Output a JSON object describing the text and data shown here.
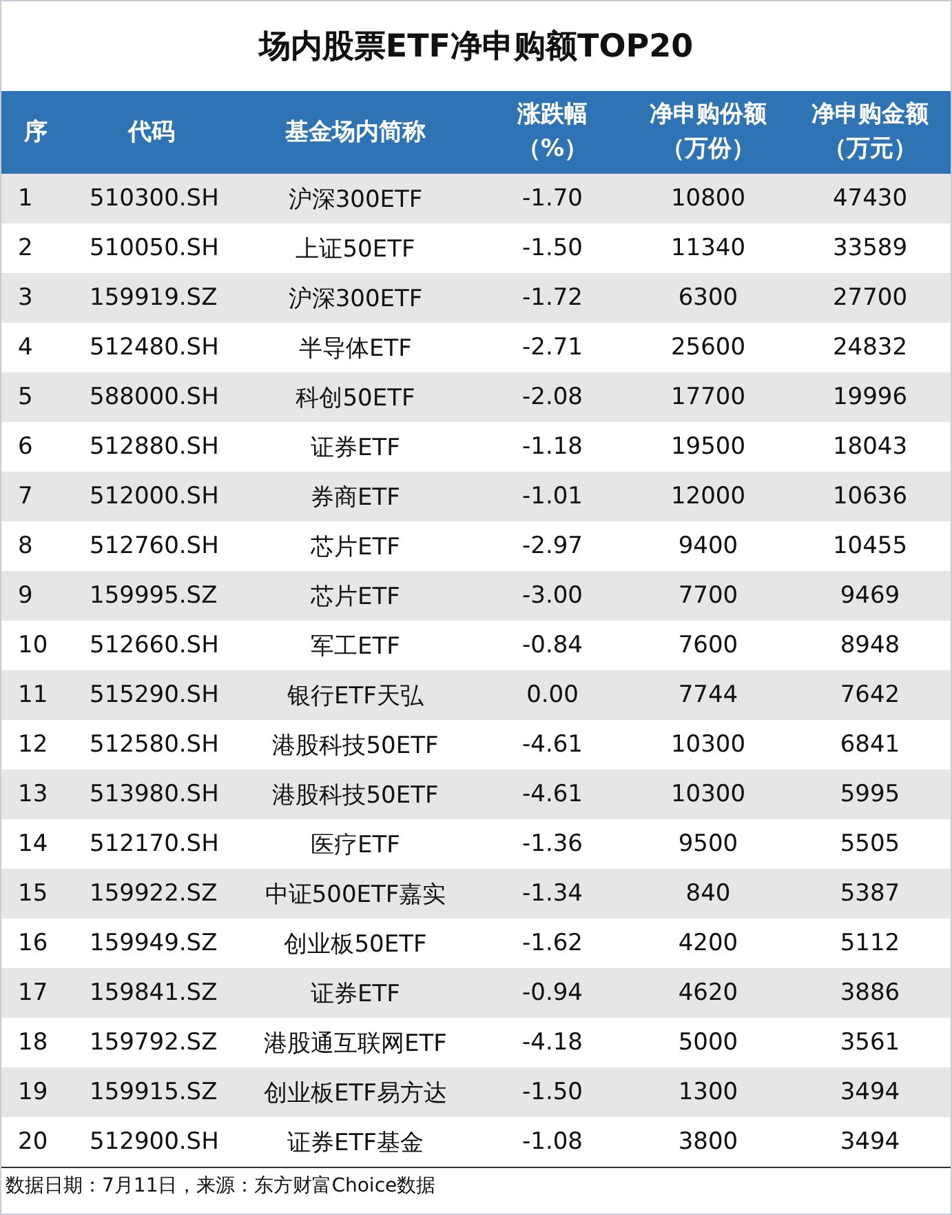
{
  "title": "场内股票ETF净申购额TOP20",
  "table": {
    "columns": [
      {
        "lines": [
          "序"
        ]
      },
      {
        "lines": [
          "代码"
        ]
      },
      {
        "lines": [
          "基金场内简称"
        ]
      },
      {
        "lines": [
          "涨跌幅",
          "（%）"
        ]
      },
      {
        "lines": [
          "净申购份额",
          "（万份）"
        ]
      },
      {
        "lines": [
          "净申购金额",
          "（万元）"
        ]
      }
    ],
    "rows": [
      [
        "1",
        "510300.SH",
        "沪深300ETF",
        "-1.70",
        "10800",
        "47430"
      ],
      [
        "2",
        "510050.SH",
        "上证50ETF",
        "-1.50",
        "11340",
        "33589"
      ],
      [
        "3",
        "159919.SZ",
        "沪深300ETF",
        "-1.72",
        "6300",
        "27700"
      ],
      [
        "4",
        "512480.SH",
        "半导体ETF",
        "-2.71",
        "25600",
        "24832"
      ],
      [
        "5",
        "588000.SH",
        "科创50ETF",
        "-2.08",
        "17700",
        "19996"
      ],
      [
        "6",
        "512880.SH",
        "证券ETF",
        "-1.18",
        "19500",
        "18043"
      ],
      [
        "7",
        "512000.SH",
        "券商ETF",
        "-1.01",
        "12000",
        "10636"
      ],
      [
        "8",
        "512760.SH",
        "芯片ETF",
        "-2.97",
        "9400",
        "10455"
      ],
      [
        "9",
        "159995.SZ",
        "芯片ETF",
        "-3.00",
        "7700",
        "9469"
      ],
      [
        "10",
        "512660.SH",
        "军工ETF",
        "-0.84",
        "7600",
        "8948"
      ],
      [
        "11",
        "515290.SH",
        "银行ETF天弘",
        "0.00",
        "7744",
        "7642"
      ],
      [
        "12",
        "512580.SH",
        "港股科技50ETF",
        "-4.61",
        "10300",
        "6841"
      ],
      [
        "13",
        "513980.SH",
        "港股科技50ETF",
        "-4.61",
        "10300",
        "5995"
      ],
      [
        "14",
        "512170.SH",
        "医疗ETF",
        "-1.36",
        "9500",
        "5505"
      ],
      [
        "15",
        "159922.SZ",
        "中证500ETF嘉实",
        "-1.34",
        "840",
        "5387"
      ],
      [
        "16",
        "159949.SZ",
        "创业板50ETF",
        "-1.62",
        "4200",
        "5112"
      ],
      [
        "17",
        "159841.SZ",
        "证券ETF",
        "-0.94",
        "4620",
        "3886"
      ],
      [
        "18",
        "159792.SZ",
        "港股通互联网ETF",
        "-4.18",
        "5000",
        "3561"
      ],
      [
        "19",
        "159915.SZ",
        "创业板ETF易方达",
        "-1.50",
        "1300",
        "3494"
      ],
      [
        "20",
        "512900.SH",
        "证券ETF基金",
        "-1.08",
        "3800",
        "3494"
      ]
    ]
  },
  "footer": "数据日期：7月11日，来源：东方财富Choice数据"
}
